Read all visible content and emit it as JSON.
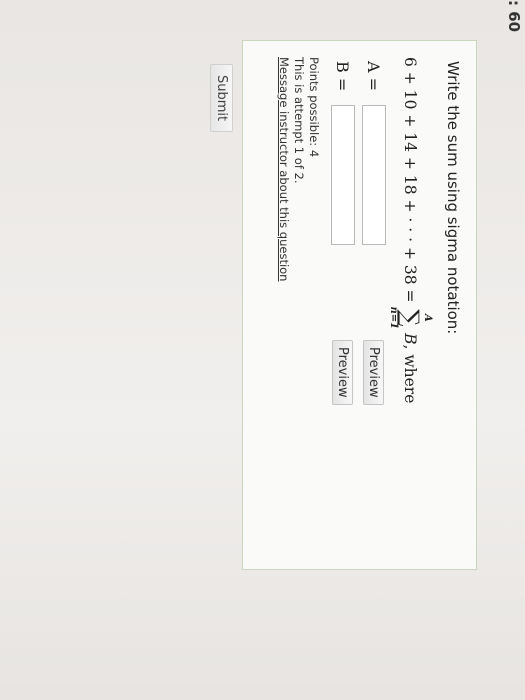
{
  "question_number": ": 60",
  "prompt": "Write the sum using sigma notation:",
  "formula": {
    "lhs": "6 + 10 + 14 + 18 + · · · + 38 =",
    "sigma_upper": "A",
    "sigma_symbol": "∑",
    "sigma_lower": "n=1",
    "term": "B",
    "suffix": ", where"
  },
  "inputs": [
    {
      "label": "A =",
      "value": "",
      "preview_label": "Preview"
    },
    {
      "label": "B =",
      "value": "",
      "preview_label": "Preview"
    }
  ],
  "meta": {
    "points": "Points possible: 4",
    "attempt": "This is attempt 1 of 2.",
    "message_link": "Message instructor about this question"
  },
  "submit_label": "Submit"
}
